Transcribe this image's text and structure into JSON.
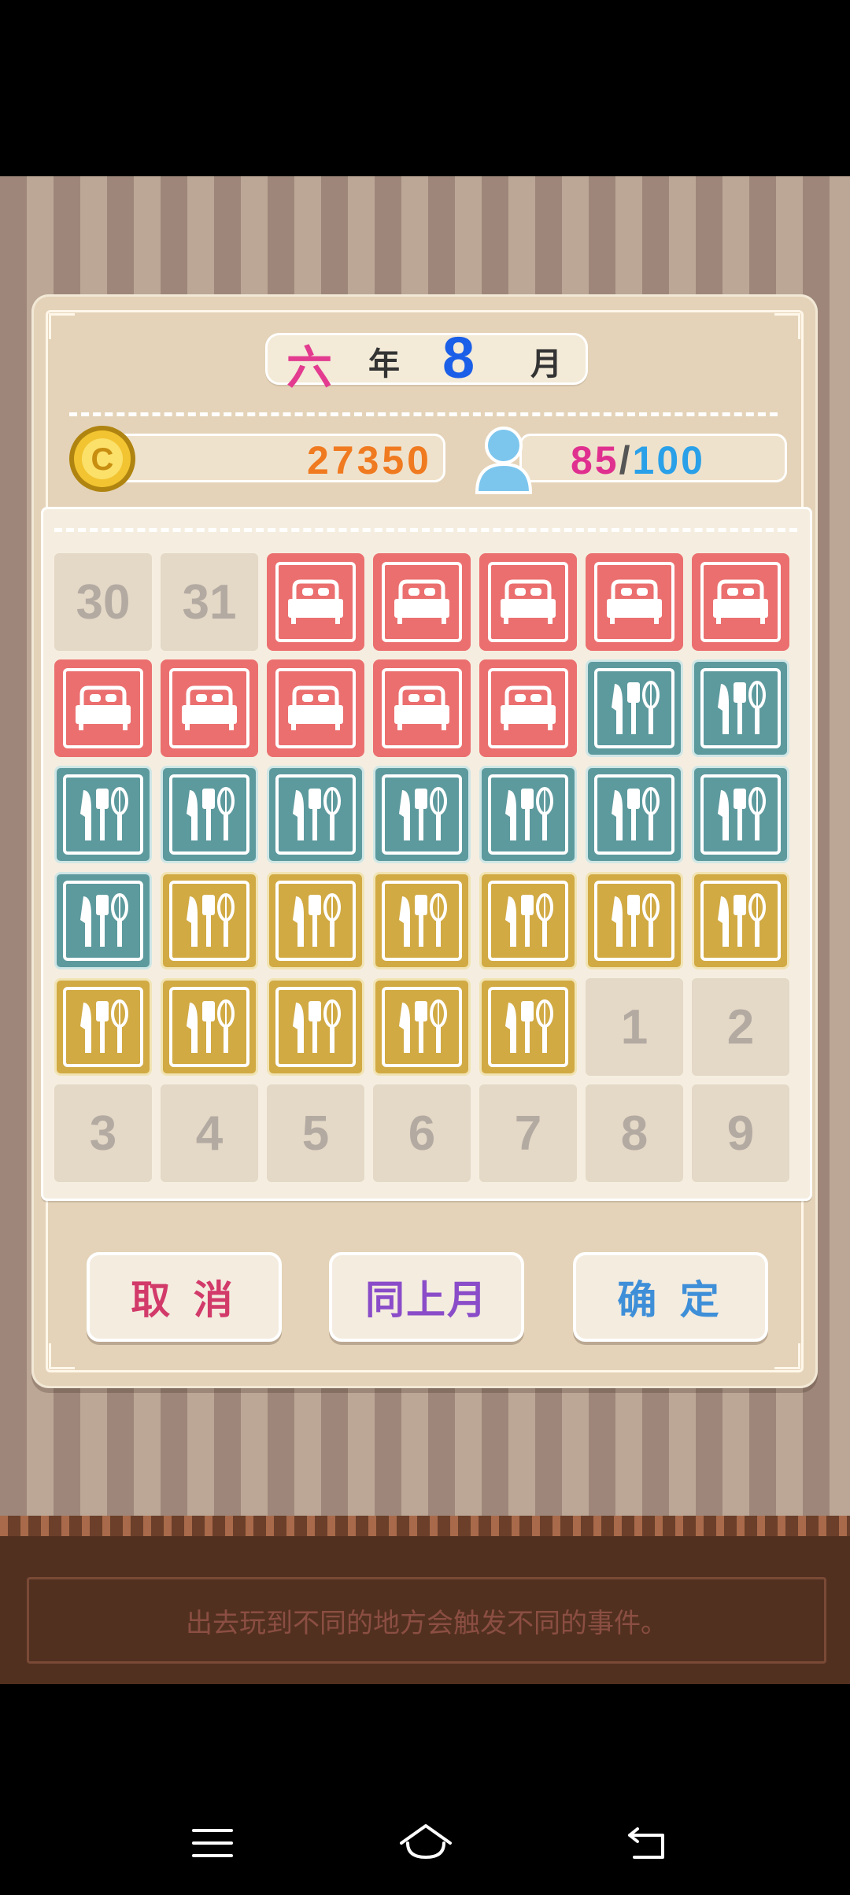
{
  "header": {
    "year_label": "六",
    "year_suffix": "年",
    "month_value": "8",
    "month_suffix": "月"
  },
  "stats": {
    "money": "27350",
    "energy_current": "85",
    "energy_separator": "/",
    "energy_max": "100"
  },
  "calendar": {
    "cells": [
      {
        "kind": "number",
        "text": "30"
      },
      {
        "kind": "number",
        "text": "31"
      },
      {
        "kind": "rest"
      },
      {
        "kind": "rest"
      },
      {
        "kind": "rest"
      },
      {
        "kind": "rest"
      },
      {
        "kind": "rest"
      },
      {
        "kind": "rest"
      },
      {
        "kind": "rest"
      },
      {
        "kind": "rest"
      },
      {
        "kind": "rest"
      },
      {
        "kind": "rest"
      },
      {
        "kind": "work-teal"
      },
      {
        "kind": "work-teal"
      },
      {
        "kind": "work-teal"
      },
      {
        "kind": "work-teal"
      },
      {
        "kind": "work-teal"
      },
      {
        "kind": "work-teal"
      },
      {
        "kind": "work-teal"
      },
      {
        "kind": "work-teal"
      },
      {
        "kind": "work-teal"
      },
      {
        "kind": "work-teal"
      },
      {
        "kind": "work-gold"
      },
      {
        "kind": "work-gold"
      },
      {
        "kind": "work-gold"
      },
      {
        "kind": "work-gold"
      },
      {
        "kind": "work-gold"
      },
      {
        "kind": "work-gold"
      },
      {
        "kind": "work-gold"
      },
      {
        "kind": "work-gold"
      },
      {
        "kind": "work-gold"
      },
      {
        "kind": "work-gold"
      },
      {
        "kind": "work-gold"
      },
      {
        "kind": "number",
        "text": "1"
      },
      {
        "kind": "number",
        "text": "2"
      },
      {
        "kind": "number",
        "text": "3"
      },
      {
        "kind": "number",
        "text": "4"
      },
      {
        "kind": "number",
        "text": "5"
      },
      {
        "kind": "number",
        "text": "6"
      },
      {
        "kind": "number",
        "text": "7"
      },
      {
        "kind": "number",
        "text": "8"
      },
      {
        "kind": "number",
        "text": "9"
      }
    ]
  },
  "buttons": {
    "cancel": "取 消",
    "same_as_last": "同上月",
    "confirm": "确 定"
  },
  "tip": "出去玩到不同的地方会触发不同的事件。",
  "colors": {
    "rest": "#eb6f6f",
    "work_teal": "#5d9a9e",
    "work_gold": "#d1aa44",
    "year": "#e33b8f",
    "month": "#1b5fe8",
    "money": "#f07a20",
    "energy_current": "#e0308f",
    "energy_max": "#2aa0e8"
  },
  "icons": {
    "money": "coin-icon",
    "energy": "person-icon",
    "rest": "bed-icon",
    "work": "utensils-icon"
  },
  "navbar": {
    "icons": [
      "menu-icon",
      "home-icon",
      "back-icon"
    ]
  }
}
